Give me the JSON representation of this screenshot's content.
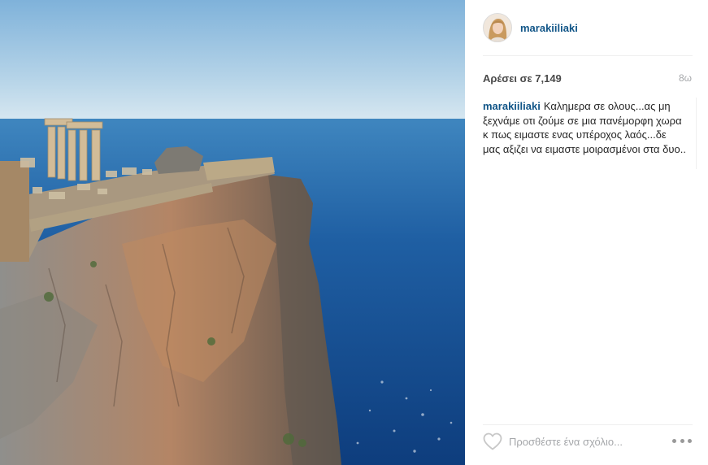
{
  "post": {
    "username": "marakiiliaki",
    "likes_text": "Αρέσει σε 7,149",
    "time_ago": "8ω",
    "caption_user": "marakiiliaki",
    "caption_text": "Καλημερα σε ολους...ας μη ξεχνάμε οτι ζούμε σε μια πανέμορφη χωρα κ πως ειμαστε ενας υπέροχος λαός...δε μας αξιζει να ειμαστε μοιρασμένοι στα δυο.."
  },
  "comment": {
    "placeholder": "Προσθέστε ένα σχόλιο..."
  },
  "icons": {
    "like": "heart-outline-icon",
    "more": "ellipsis-icon"
  },
  "colors": {
    "username": "#125688",
    "likes": "#4a4a4a",
    "muted": "#a5a7aa",
    "sea": "#1f5fa3",
    "sky": "#bcd8ea"
  }
}
